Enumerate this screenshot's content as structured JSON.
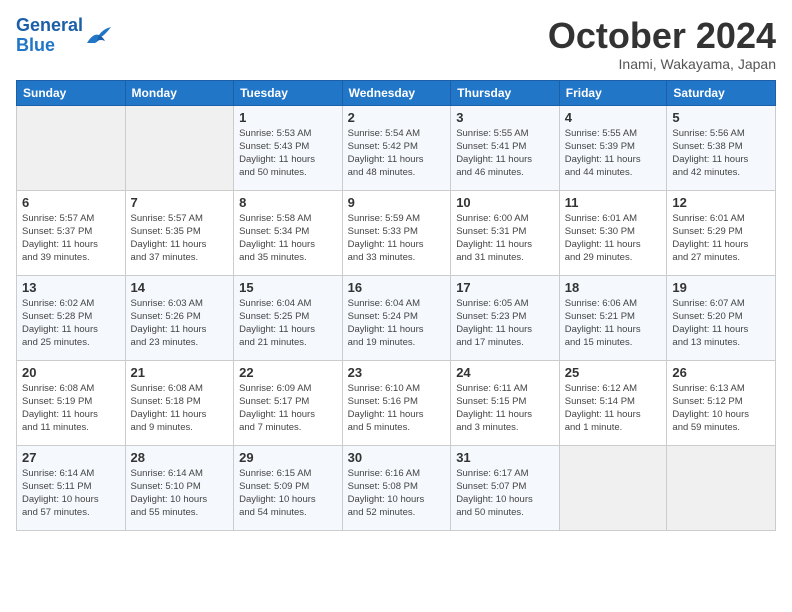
{
  "header": {
    "logo_line1": "General",
    "logo_line2": "Blue",
    "month": "October 2024",
    "location": "Inami, Wakayama, Japan"
  },
  "weekdays": [
    "Sunday",
    "Monday",
    "Tuesday",
    "Wednesday",
    "Thursday",
    "Friday",
    "Saturday"
  ],
  "weeks": [
    [
      {
        "day": "",
        "info": ""
      },
      {
        "day": "",
        "info": ""
      },
      {
        "day": "1",
        "info": "Sunrise: 5:53 AM\nSunset: 5:43 PM\nDaylight: 11 hours\nand 50 minutes."
      },
      {
        "day": "2",
        "info": "Sunrise: 5:54 AM\nSunset: 5:42 PM\nDaylight: 11 hours\nand 48 minutes."
      },
      {
        "day": "3",
        "info": "Sunrise: 5:55 AM\nSunset: 5:41 PM\nDaylight: 11 hours\nand 46 minutes."
      },
      {
        "day": "4",
        "info": "Sunrise: 5:55 AM\nSunset: 5:39 PM\nDaylight: 11 hours\nand 44 minutes."
      },
      {
        "day": "5",
        "info": "Sunrise: 5:56 AM\nSunset: 5:38 PM\nDaylight: 11 hours\nand 42 minutes."
      }
    ],
    [
      {
        "day": "6",
        "info": "Sunrise: 5:57 AM\nSunset: 5:37 PM\nDaylight: 11 hours\nand 39 minutes."
      },
      {
        "day": "7",
        "info": "Sunrise: 5:57 AM\nSunset: 5:35 PM\nDaylight: 11 hours\nand 37 minutes."
      },
      {
        "day": "8",
        "info": "Sunrise: 5:58 AM\nSunset: 5:34 PM\nDaylight: 11 hours\nand 35 minutes."
      },
      {
        "day": "9",
        "info": "Sunrise: 5:59 AM\nSunset: 5:33 PM\nDaylight: 11 hours\nand 33 minutes."
      },
      {
        "day": "10",
        "info": "Sunrise: 6:00 AM\nSunset: 5:31 PM\nDaylight: 11 hours\nand 31 minutes."
      },
      {
        "day": "11",
        "info": "Sunrise: 6:01 AM\nSunset: 5:30 PM\nDaylight: 11 hours\nand 29 minutes."
      },
      {
        "day": "12",
        "info": "Sunrise: 6:01 AM\nSunset: 5:29 PM\nDaylight: 11 hours\nand 27 minutes."
      }
    ],
    [
      {
        "day": "13",
        "info": "Sunrise: 6:02 AM\nSunset: 5:28 PM\nDaylight: 11 hours\nand 25 minutes."
      },
      {
        "day": "14",
        "info": "Sunrise: 6:03 AM\nSunset: 5:26 PM\nDaylight: 11 hours\nand 23 minutes."
      },
      {
        "day": "15",
        "info": "Sunrise: 6:04 AM\nSunset: 5:25 PM\nDaylight: 11 hours\nand 21 minutes."
      },
      {
        "day": "16",
        "info": "Sunrise: 6:04 AM\nSunset: 5:24 PM\nDaylight: 11 hours\nand 19 minutes."
      },
      {
        "day": "17",
        "info": "Sunrise: 6:05 AM\nSunset: 5:23 PM\nDaylight: 11 hours\nand 17 minutes."
      },
      {
        "day": "18",
        "info": "Sunrise: 6:06 AM\nSunset: 5:21 PM\nDaylight: 11 hours\nand 15 minutes."
      },
      {
        "day": "19",
        "info": "Sunrise: 6:07 AM\nSunset: 5:20 PM\nDaylight: 11 hours\nand 13 minutes."
      }
    ],
    [
      {
        "day": "20",
        "info": "Sunrise: 6:08 AM\nSunset: 5:19 PM\nDaylight: 11 hours\nand 11 minutes."
      },
      {
        "day": "21",
        "info": "Sunrise: 6:08 AM\nSunset: 5:18 PM\nDaylight: 11 hours\nand 9 minutes."
      },
      {
        "day": "22",
        "info": "Sunrise: 6:09 AM\nSunset: 5:17 PM\nDaylight: 11 hours\nand 7 minutes."
      },
      {
        "day": "23",
        "info": "Sunrise: 6:10 AM\nSunset: 5:16 PM\nDaylight: 11 hours\nand 5 minutes."
      },
      {
        "day": "24",
        "info": "Sunrise: 6:11 AM\nSunset: 5:15 PM\nDaylight: 11 hours\nand 3 minutes."
      },
      {
        "day": "25",
        "info": "Sunrise: 6:12 AM\nSunset: 5:14 PM\nDaylight: 11 hours\nand 1 minute."
      },
      {
        "day": "26",
        "info": "Sunrise: 6:13 AM\nSunset: 5:12 PM\nDaylight: 10 hours\nand 59 minutes."
      }
    ],
    [
      {
        "day": "27",
        "info": "Sunrise: 6:14 AM\nSunset: 5:11 PM\nDaylight: 10 hours\nand 57 minutes."
      },
      {
        "day": "28",
        "info": "Sunrise: 6:14 AM\nSunset: 5:10 PM\nDaylight: 10 hours\nand 55 minutes."
      },
      {
        "day": "29",
        "info": "Sunrise: 6:15 AM\nSunset: 5:09 PM\nDaylight: 10 hours\nand 54 minutes."
      },
      {
        "day": "30",
        "info": "Sunrise: 6:16 AM\nSunset: 5:08 PM\nDaylight: 10 hours\nand 52 minutes."
      },
      {
        "day": "31",
        "info": "Sunrise: 6:17 AM\nSunset: 5:07 PM\nDaylight: 10 hours\nand 50 minutes."
      },
      {
        "day": "",
        "info": ""
      },
      {
        "day": "",
        "info": ""
      }
    ]
  ]
}
